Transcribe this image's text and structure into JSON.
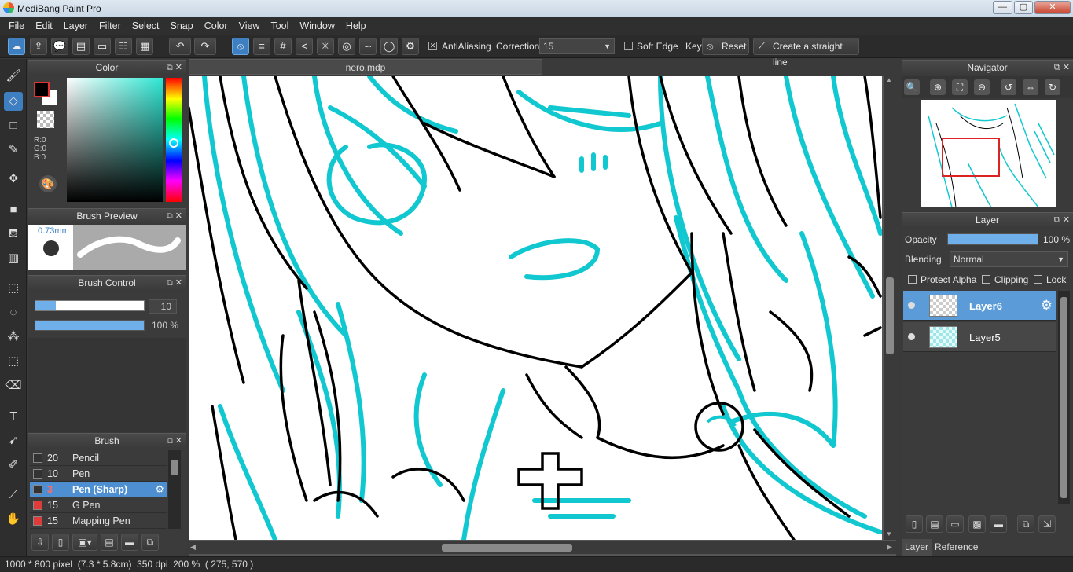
{
  "window": {
    "title": "MediBang Paint Pro",
    "min": "—",
    "max": "▢",
    "close": "✕"
  },
  "menu": [
    "File",
    "Edit",
    "Layer",
    "Filter",
    "Select",
    "Snap",
    "Color",
    "View",
    "Tool",
    "Window",
    "Help"
  ],
  "toolbar": {
    "antialiasing_label": "AntiAliasing",
    "antialiasing_checked": "✕",
    "correction_label": "Correction",
    "correction_value": "15",
    "soft_edge_label": "Soft Edge",
    "key_label": "Key",
    "reset_label": "Reset",
    "straight_line_label": "Create a straight line"
  },
  "color_panel": {
    "title": "Color",
    "r": "R:0",
    "g": "G:0",
    "b": "B:0",
    "primary_color": "#000000",
    "secondary_color": "#ffffff",
    "hue_color": "#2fe8d4"
  },
  "brush_preview": {
    "title": "Brush Preview",
    "size": "0.73mm"
  },
  "brush_control": {
    "title": "Brush Control",
    "size_value": "10",
    "opacity_value": "100 %",
    "size_fraction": 0.19,
    "opacity_fraction": 1.0
  },
  "brush_panel": {
    "title": "Brush",
    "items": [
      {
        "size": "20",
        "name": "Pencil",
        "color": "#333333"
      },
      {
        "size": "10",
        "name": "Pen",
        "color": "#333333"
      },
      {
        "size": "3",
        "name": "Pen (Sharp)",
        "color": "#333333",
        "active": true
      },
      {
        "size": "15",
        "name": "G Pen",
        "color": "#e03b3b"
      },
      {
        "size": "15",
        "name": "Mapping Pen",
        "color": "#e03b3b"
      }
    ]
  },
  "document": {
    "tab": "nero.mdp"
  },
  "navigator": {
    "title": "Navigator"
  },
  "layer_panel": {
    "title": "Layer",
    "opacity_label": "Opacity",
    "opacity_value": "100 %",
    "blending_label": "Blending",
    "blending_value": "Normal",
    "protect_alpha_label": "Protect Alpha",
    "clipping_label": "Clipping",
    "lock_label": "Lock",
    "layers": [
      {
        "name": "Layer6",
        "active": true
      },
      {
        "name": "Layer5",
        "active": false
      }
    ]
  },
  "bottom_tabs": {
    "layer": "Layer",
    "reference": "Reference"
  },
  "status": {
    "size": "1000 * 800 pixel",
    "physical": "(7.3 * 5.8cm)",
    "dpi": "350 dpi",
    "zoom": "200 %",
    "coords": "( 275, 570 )"
  },
  "colors": {
    "accent": "#3e7fc1",
    "line_cyan": "#12c8d0"
  }
}
